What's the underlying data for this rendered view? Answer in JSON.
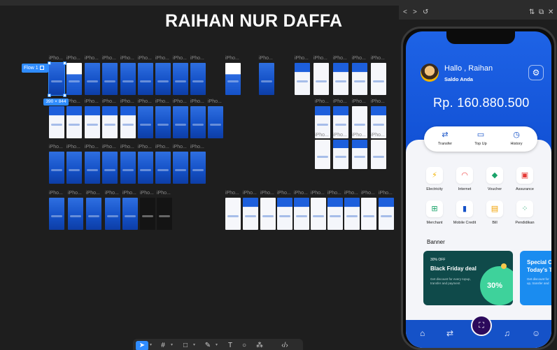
{
  "canvas": {
    "title": "RAIHAN NUR DAFFA",
    "frame_label": "iPho...",
    "flow_tag": "Flow 1",
    "dimension_tag": "390 × 844"
  },
  "prototype_window": {
    "nav_back": "<",
    "nav_forward": ">",
    "nav_restart": "↺",
    "action_settings": "⇅",
    "action_open": "⧉",
    "action_close": "✕"
  },
  "app": {
    "greeting": "Hallo , Raihan",
    "balance_label": "Saldo Anda",
    "balance": "Rp. 160.880.500",
    "quick_actions": [
      "Transfer",
      "Top Up",
      "History"
    ],
    "services": [
      "Electricity",
      "Internet",
      "Voucher",
      "Assurance",
      "Merchant",
      "Mobile Credit",
      "Bill",
      "Pendidikan"
    ],
    "banner_section": "Banner",
    "banner1": {
      "tag": "30% OFF",
      "title": "Black Friday deal",
      "desc": "Get discount for every topup, transfer and payment",
      "percent": "30%"
    },
    "banner2": {
      "title_line1": "Special O",
      "title_line2": "Today's T",
      "desc_line1": "Get discount for",
      "desc_line2": "up, transfer and"
    }
  },
  "toolbar": {
    "tools": [
      "move-tool",
      "frame-tool",
      "shape-tool",
      "pen-tool",
      "text-tool",
      "comment-tool",
      "actions-tool",
      "dev-mode-tool"
    ]
  }
}
